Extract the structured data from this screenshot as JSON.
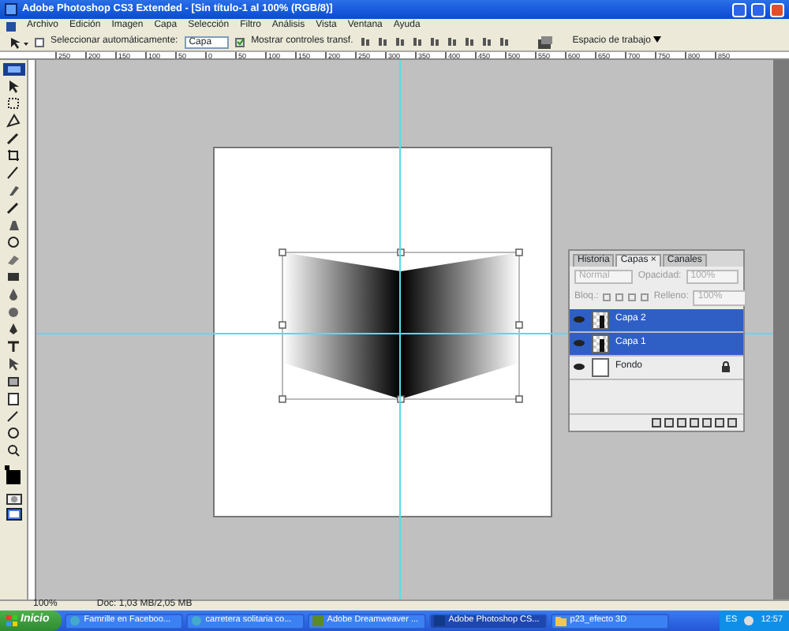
{
  "window": {
    "title": "Adobe Photoshop CS3 Extended - [Sin título-1 al 100% (RGB/8)]"
  },
  "menu": [
    "Archivo",
    "Edición",
    "Imagen",
    "Capa",
    "Selección",
    "Filtro",
    "Análisis",
    "Vista",
    "Ventana",
    "Ayuda"
  ],
  "options_bar": {
    "auto_select": {
      "label": "Seleccionar automáticamente:",
      "checked": false
    },
    "auto_select_target": "Capa",
    "show_transform": {
      "label": "Mostrar controles transf.",
      "checked": true
    },
    "workspace_button": "Espacio de trabajo"
  },
  "ruler": {
    "labels": [
      "250",
      "200",
      "150",
      "100",
      "50",
      "0",
      "50",
      "100",
      "150",
      "200",
      "250",
      "300",
      "350",
      "400",
      "450",
      "500",
      "550",
      "600",
      "650",
      "700",
      "750",
      "800",
      "850"
    ]
  },
  "layers_panel": {
    "tabs": [
      {
        "label": "Historia",
        "selected": false
      },
      {
        "label": "Capas",
        "selected": true,
        "close_glyph": "×"
      },
      {
        "label": "Canales",
        "selected": false
      }
    ],
    "blend_mode": "Normal",
    "opacity_label": "Opacidad:",
    "opacity": "100%",
    "lock_label": "Bloq.:",
    "fill_label": "Relleno:",
    "fill": "100%",
    "layers": [
      {
        "name": "Capa 2",
        "kind": "layer",
        "selected": true,
        "locked": false
      },
      {
        "name": "Capa 1",
        "kind": "layer",
        "selected": true,
        "locked": false
      },
      {
        "name": "Fondo",
        "kind": "background",
        "selected": false,
        "locked": true
      }
    ]
  },
  "status_bar": {
    "zoom": "100%",
    "doc_info": "Doc: 1,03 MB/2,05 MB"
  },
  "taskbar": {
    "start": "Inicio",
    "items": [
      {
        "label": "Famrille en Faceboo...",
        "kind": "browser",
        "selected": false
      },
      {
        "label": "carretera solitaria co...",
        "kind": "browser",
        "selected": false
      },
      {
        "label": "Adobe Dreamweaver ...",
        "kind": "dreamweaver",
        "selected": false
      },
      {
        "label": "Adobe Photoshop CS...",
        "kind": "photoshop",
        "selected": true
      },
      {
        "label": "p23_efecto 3D",
        "kind": "folder",
        "selected": false
      }
    ],
    "language": "ES",
    "clock": "12:57"
  }
}
